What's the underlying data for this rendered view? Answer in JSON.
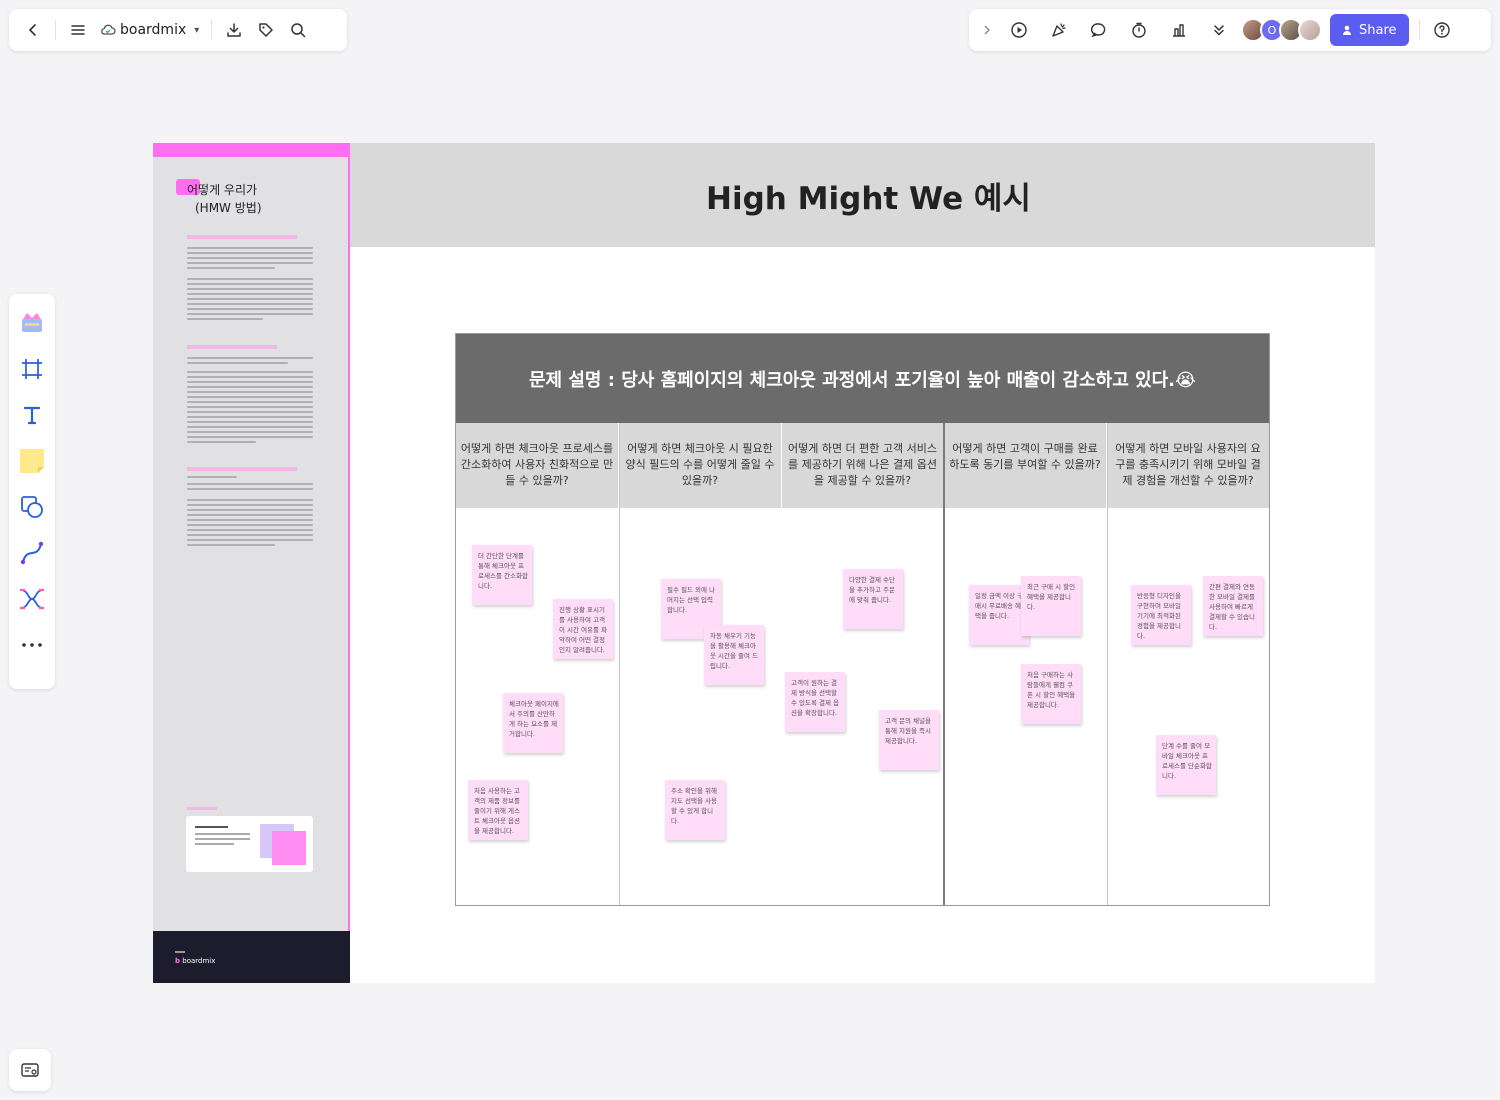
{
  "toolbar_left": {
    "brand": "boardmix"
  },
  "toolbar_right": {
    "avatar_initial": "O",
    "share_label": "Share"
  },
  "board": {
    "title": "High Might We 예시",
    "left_panel": {
      "heading_line1": "어떻게 우리가",
      "heading_line2": "(HMW 방법)",
      "footer_brand": "boardmix"
    },
    "problem": "문제 설명 : 당사 홈페이지의 체크아웃 과정에서 포기율이 높아 매출이 감소하고 있다.😭",
    "questions": [
      "어떻게 하면 체크아웃 프로세스를 간소화하여 사용자 친화적으로 만들 수 있을까?",
      "어떻게 하면 체크아웃 시 필요한 양식 필드의 수를 어떻게 줄일 수 있을까?",
      "어떻게 하면 더 편한 고객 서비스를 제공하기 위해 나은 결제 옵션을 제공할 수 있을까?",
      "어떻게 하면 고객이 구매를 완료하도록 동기를 부여할 수 있을까?",
      "어떻게 하면 모바일 사용자의 요구를 충족시키기 위해 모바일 결제 경험을 개선할 수 있을까?"
    ],
    "notes": [
      {
        "text": "더 간단한 단계를 통해 체크아웃 프로세스를 간소화합니다."
      },
      {
        "text": "진행 상황 표시기를 사용하여 고객이 시간 여유를 파악하여 어떤 결정인지 알려줍니다."
      },
      {
        "text": "체크아웃 페이지에서 주의를 산만하게 하는 요소를 제거합니다."
      },
      {
        "text": "처음 사용하는 고객의 제품 정보를 줄이기 위해 게스트 체크아웃 옵션을 제공합니다."
      },
      {
        "text": "필수 필드 외에 나머지는 선택 입력합니다."
      },
      {
        "text": "자동 채우기 기능을 활용해 체크아웃 시간을 줄여 드립니다."
      },
      {
        "text": "주소 확인을 위해 지도 선택을 사용할 수 있게 합니다."
      },
      {
        "text": "다양한 결제 수단을 추가하고 주문에 맞춰 줍니다."
      },
      {
        "text": "고객이 원하는 결제 방식을 선택할 수 있도록 결제 옵션을 확장합니다."
      },
      {
        "text": "고객 문의 채널을 통해 지원을 즉시 제공합니다."
      },
      {
        "text": "일정 금액 이상 구매시 무료배송 혜택을 줍니다."
      },
      {
        "text": "최근 구매 시 할인 혜택을 제공합니다."
      },
      {
        "text": "처음 구매하는 사람들에게 웰컴 쿠폰 시 할인 혜택을 제공합니다."
      },
      {
        "text": "반응형 디자인을 구현하여 모바일 기기에 최적화된 경험을 제공합니다."
      },
      {
        "text": "간편 결제와 연동한 모바일 결제를 사용하여 빠르게 결제할 수 있습니다."
      },
      {
        "text": "단계 수를 줄여 모바일 체크아웃 프로세스를 단순화합니다."
      }
    ]
  }
}
